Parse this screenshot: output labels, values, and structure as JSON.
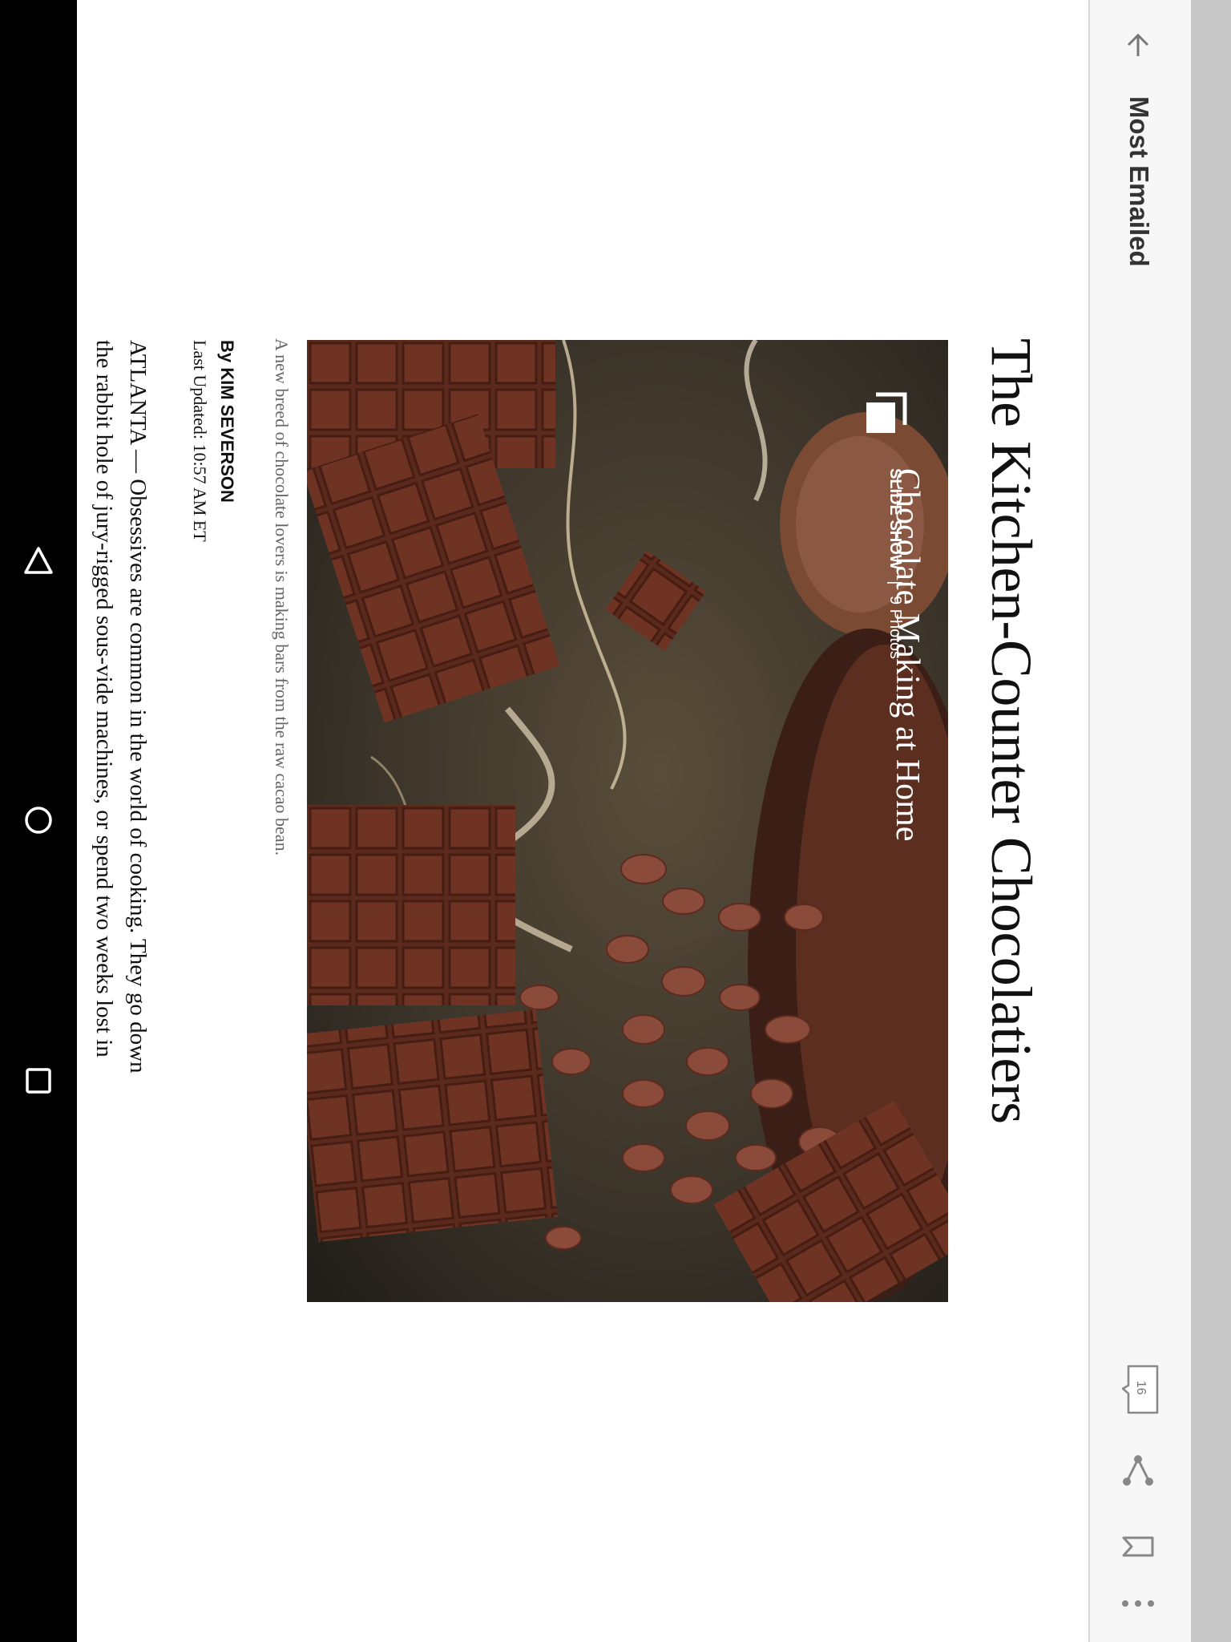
{
  "toolbar": {
    "section_title": "Most Emailed",
    "comment_count": "16",
    "icons": [
      "back-arrow-icon",
      "comment-icon",
      "share-icon",
      "save-icon",
      "more-icon"
    ]
  },
  "article": {
    "headline": "The Kitchen-Counter Chocolatiers",
    "slideshow": {
      "label": "SLIDE SHOW",
      "separator": "|",
      "count": "9 Photos",
      "title": "Chocolate Making at Home"
    },
    "caption": "A new breed of chocolate lovers is making bars from the raw cacao bean.",
    "byline": "By KIM SEVERSON",
    "updated": "Last Updated: 10:57 AM ET",
    "body_lines": [
      "ATLANTA — Obsessives are common in the world of cooking. They go down",
      "the rabbit hole of jury-rigged sous-vide machines, or spend two weeks lost in"
    ]
  },
  "navbar": {
    "icons": [
      "back-triangle-icon",
      "home-circle-icon",
      "recents-square-icon"
    ]
  }
}
